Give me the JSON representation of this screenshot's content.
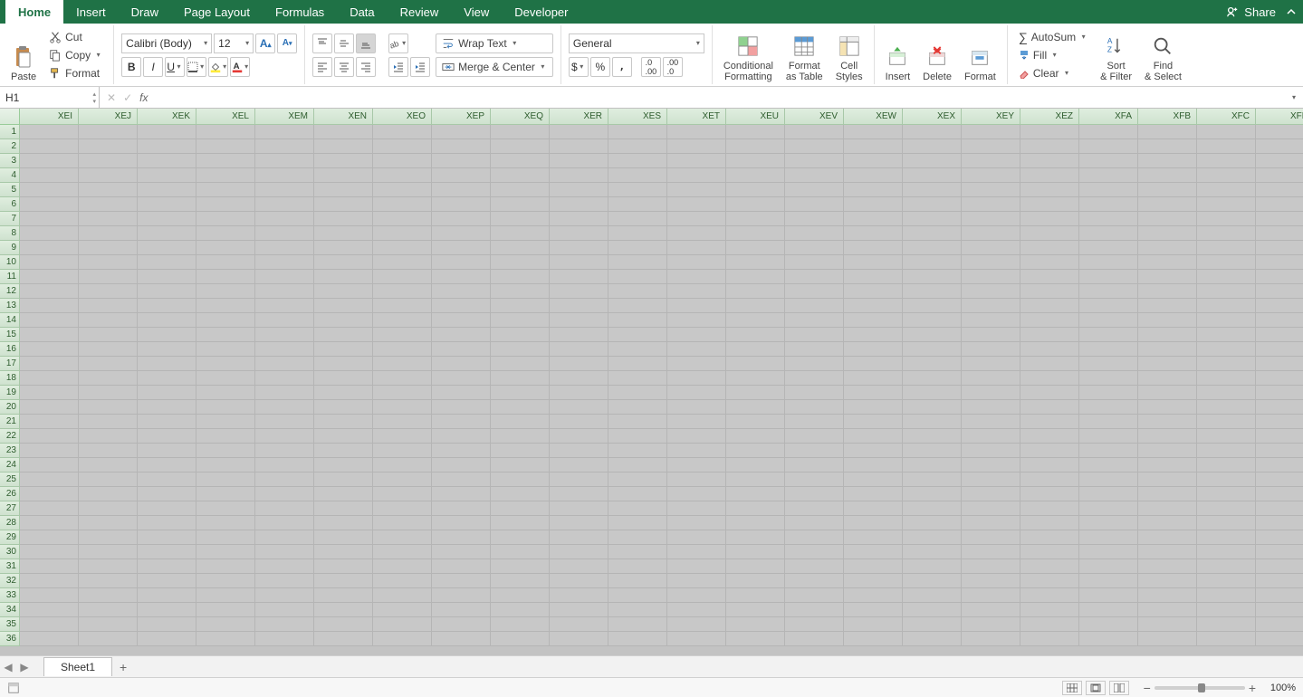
{
  "tabs": {
    "items": [
      "Home",
      "Insert",
      "Draw",
      "Page Layout",
      "Formulas",
      "Data",
      "Review",
      "View",
      "Developer"
    ],
    "active": 0,
    "share": "Share"
  },
  "clipboard": {
    "paste": "Paste",
    "cut": "Cut",
    "copy": "Copy",
    "format": "Format"
  },
  "font": {
    "name": "Calibri (Body)",
    "size": "12"
  },
  "align": {
    "wrap": "Wrap Text",
    "merge": "Merge & Center"
  },
  "number": {
    "format": "General"
  },
  "styles": {
    "cf": "Conditional Formatting",
    "table": "Format as Table",
    "cell": "Cell Styles"
  },
  "cells_g": {
    "insert": "Insert",
    "delete": "Delete",
    "format": "Format"
  },
  "editing": {
    "autosum": "AutoSum",
    "fill": "Fill",
    "clear": "Clear",
    "sort": "Sort & Filter",
    "find": "Find & Select"
  },
  "namebox": "H1",
  "fx": "fx",
  "columns": [
    "XEI",
    "XEJ",
    "XEK",
    "XEL",
    "XEM",
    "XEN",
    "XEO",
    "XEP",
    "XEQ",
    "XER",
    "XES",
    "XET",
    "XEU",
    "XEV",
    "XEW",
    "XEX",
    "XEY",
    "XEZ",
    "XFA",
    "XFB",
    "XFC",
    "XFD"
  ],
  "rowstart": 1,
  "rowend": 36,
  "sheet": {
    "name": "Sheet1"
  },
  "zoom": "100%"
}
